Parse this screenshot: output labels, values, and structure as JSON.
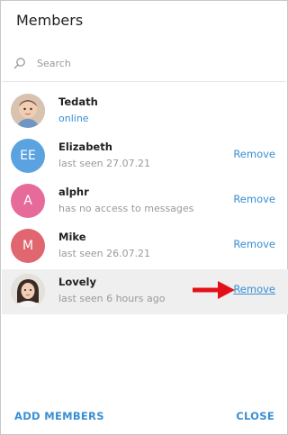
{
  "dialog": {
    "title": "Members",
    "search_placeholder": "Search",
    "add_members_label": "ADD MEMBERS",
    "close_label": "CLOSE"
  },
  "members": [
    {
      "name": "Tedath",
      "status": "online",
      "avatar": "photo"
    },
    {
      "name": "Elizabeth",
      "status": "last seen 27.07.21",
      "initials": "EE",
      "avatar_color": "#5aa3e0",
      "remove_label": "Remove"
    },
    {
      "name": "alphr",
      "status": "has no access to messages",
      "initials": "A",
      "avatar_color": "#e66b9a",
      "remove_label": "Remove"
    },
    {
      "name": "Mike",
      "status": "last seen 26.07.21",
      "initials": "M",
      "avatar_color": "#e06670",
      "remove_label": "Remove"
    },
    {
      "name": "Lovely",
      "status": "last seen 6 hours ago",
      "avatar": "photo",
      "remove_label": "Remove"
    }
  ],
  "colors": {
    "accent": "#3a8fd3",
    "highlight_row": "#efefef",
    "arrow": "#e3101a"
  },
  "icons": {
    "search": "search-icon",
    "arrow": "red-arrow-icon"
  }
}
